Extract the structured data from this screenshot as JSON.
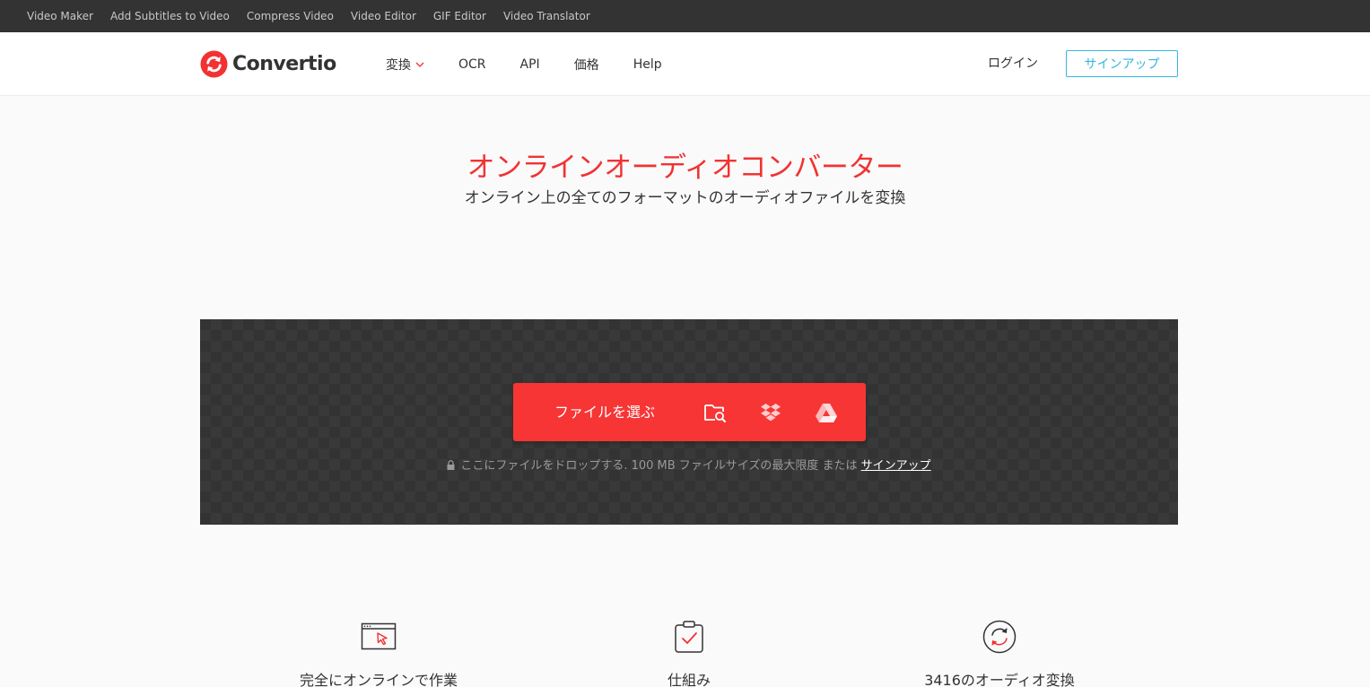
{
  "topbar": {
    "links": [
      "Video Maker",
      "Add Subtitles to Video",
      "Compress Video",
      "Video Editor",
      "GIF Editor",
      "Video Translator"
    ]
  },
  "header": {
    "logo_text": "Convertio",
    "nav": {
      "convert": "変換",
      "ocr": "OCR",
      "api": "API",
      "pricing": "価格",
      "help": "Help"
    },
    "login": "ログイン",
    "signup": "サインアップ"
  },
  "hero": {
    "title": "オンラインオーディオコンバーター",
    "subtitle": "オンライン上の全てのフォーマットのオーディオファイルを変換"
  },
  "upload": {
    "choose_label": "ファイルを選ぶ",
    "icons": [
      "folder-search-icon",
      "dropbox-icon",
      "google-drive-icon"
    ],
    "drop_text": "ここにファイルをドロップする. 100 MB ファイルサイズの最大限度 または ",
    "signup_link": "サインアップ"
  },
  "features": [
    {
      "label": "完全にオンラインで作業",
      "icon": "browser-cursor-icon"
    },
    {
      "label": "仕組み",
      "icon": "clipboard-check-icon"
    },
    {
      "label": "3416のオーディオ変換",
      "icon": "refresh-circle-icon"
    }
  ],
  "colors": {
    "brand_red": "#f23232",
    "button_red": "#f73535",
    "accent_blue": "#36b6e0",
    "topbar": "#333333"
  }
}
